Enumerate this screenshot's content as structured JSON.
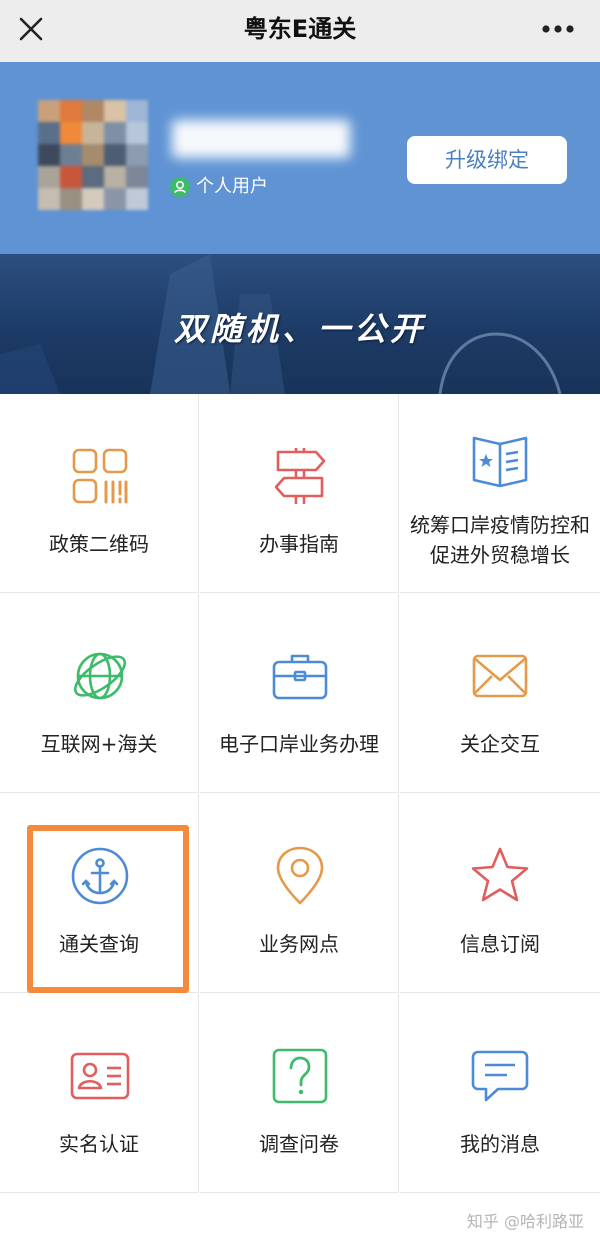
{
  "header": {
    "title": "粤东E通关",
    "close_icon": "close-icon",
    "more_icon": "more-icon"
  },
  "profile": {
    "user_type": "个人用户",
    "upgrade_button": "升级绑定",
    "background_color": "#5f93d3"
  },
  "banner": {
    "slogan": "双随机、一公开"
  },
  "grid": {
    "items": [
      {
        "label": "政策二维码",
        "icon": "qr-code-icon",
        "color": "#e59a4b"
      },
      {
        "label": "办事指南",
        "icon": "signpost-icon",
        "color": "#e25d5d"
      },
      {
        "label": "统筹口岸疫情防控和促进外贸稳增长",
        "icon": "book-icon",
        "color": "#4e8bd6"
      },
      {
        "label": "互联网+海关",
        "icon": "globe-icon",
        "color": "#3dbb6a"
      },
      {
        "label": "电子口岸业务办理",
        "icon": "briefcase-icon",
        "color": "#4e8bd6"
      },
      {
        "label": "关企交互",
        "icon": "envelope-icon",
        "color": "#e59a4b"
      },
      {
        "label": "通关查询",
        "icon": "anchor-icon",
        "color": "#4e8bd6"
      },
      {
        "label": "业务网点",
        "icon": "location-pin-icon",
        "color": "#e59a4b"
      },
      {
        "label": "信息订阅",
        "icon": "star-icon",
        "color": "#e25d5d"
      },
      {
        "label": "实名认证",
        "icon": "id-card-icon",
        "color": "#e25d5d"
      },
      {
        "label": "调查问卷",
        "icon": "question-icon",
        "color": "#3dbb6a"
      },
      {
        "label": "我的消息",
        "icon": "message-icon",
        "color": "#4e8bd6"
      }
    ]
  },
  "highlight": {
    "color": "#f48a3c",
    "target": "通关查询"
  },
  "watermark": "知乎 @哈利路亚"
}
